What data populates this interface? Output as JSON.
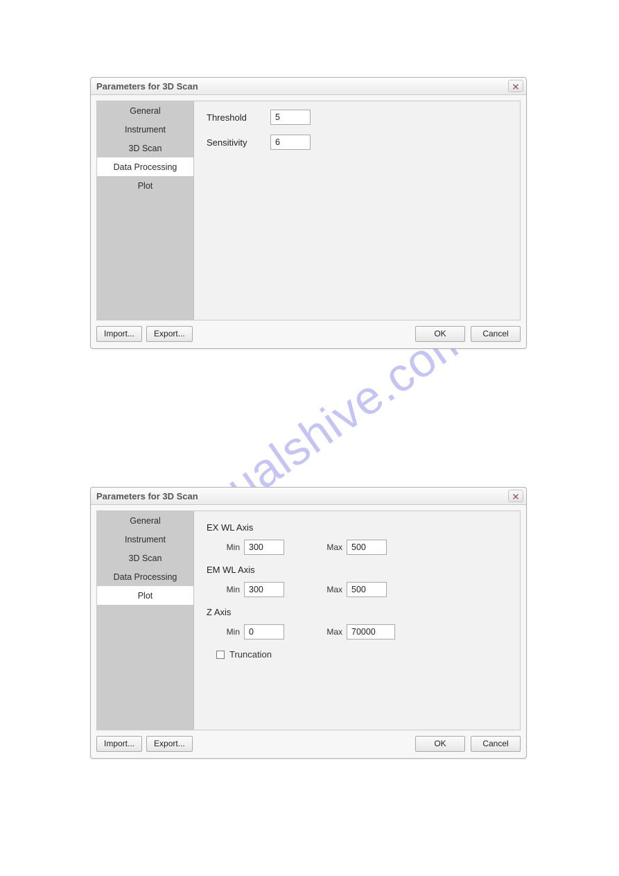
{
  "watermark": "manualshive.com",
  "dialog1": {
    "title": "Parameters for 3D Scan",
    "sidebar": {
      "items": [
        "General",
        "Instrument",
        "3D Scan",
        "Data Processing",
        "Plot"
      ],
      "selected_index": 3
    },
    "panel": {
      "threshold_label": "Threshold",
      "threshold_value": "5",
      "sensitivity_label": "Sensitivity",
      "sensitivity_value": "6"
    },
    "footer": {
      "import": "Import...",
      "export": "Export...",
      "ok": "OK",
      "cancel": "Cancel"
    }
  },
  "dialog2": {
    "title": "Parameters for 3D Scan",
    "sidebar": {
      "items": [
        "General",
        "Instrument",
        "3D Scan",
        "Data Processing",
        "Plot"
      ],
      "selected_index": 4
    },
    "panel": {
      "ex_axis_label": "EX WL Axis",
      "em_axis_label": "EM WL Axis",
      "z_axis_label": "Z Axis",
      "min_label": "Min",
      "max_label": "Max",
      "ex_min": "300",
      "ex_max": "500",
      "em_min": "300",
      "em_max": "500",
      "z_min": "0",
      "z_max": "70000",
      "truncation_label": "Truncation",
      "truncation_checked": false
    },
    "footer": {
      "import": "Import...",
      "export": "Export...",
      "ok": "OK",
      "cancel": "Cancel"
    }
  }
}
